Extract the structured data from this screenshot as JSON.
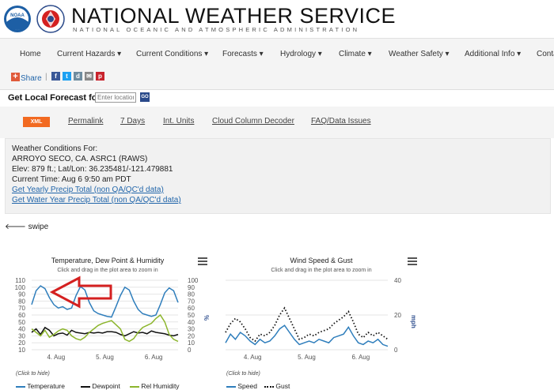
{
  "header": {
    "title": "NATIONAL WEATHER SERVICE",
    "subtitle": "NATIONAL OCEANIC AND ATMOSPHERIC ADMINISTRATION",
    "noaa_logo_text": "NOAA"
  },
  "nav": {
    "items": [
      {
        "label": "Home"
      },
      {
        "label": "Current Hazards ▾"
      },
      {
        "label": "Current Conditions ▾"
      },
      {
        "label": "Forecasts ▾"
      },
      {
        "label": "Hydrology ▾"
      },
      {
        "label": "Climate ▾"
      },
      {
        "label": "Weather Safety ▾"
      },
      {
        "label": "Additional Info ▾"
      },
      {
        "label": "Conta"
      }
    ]
  },
  "share": {
    "label": "Share",
    "icons": [
      "facebook-icon",
      "twitter-icon",
      "digg-icon",
      "email-icon",
      "pinterest-icon"
    ]
  },
  "forecast": {
    "label": "Get Local Forecast for:",
    "placeholder": "Enter location",
    "go_label": "GO"
  },
  "links": {
    "xml": "XML",
    "items": [
      {
        "label": "Permalink"
      },
      {
        "label": "7 Days"
      },
      {
        "label": "Int. Units"
      },
      {
        "label": "Cloud Column Decoder"
      },
      {
        "label": "FAQ/Data Issues"
      }
    ]
  },
  "conditions": {
    "heading": "Weather Conditions For:",
    "station": "ARROYO SECO, CA. ASRC1 (RAWS)",
    "elev": "Elev: 879 ft.; Lat/Lon: 36.235481/-121.479881",
    "time": "Current Time: Aug 6 9:50 am PDT",
    "link1": "Get Yearly Precip Total (non QA/QC'd data)",
    "link2": "Get Water Year Precip Total (non QA/QC'd data)"
  },
  "swipe": "swipe",
  "colors": {
    "temp": "#2f7ebc",
    "dew": "#111111",
    "rh": "#8cb52c",
    "gust": "#111111",
    "arrow": "#d42020",
    "link": "#2266aa"
  },
  "chart_data": [
    {
      "type": "line",
      "title": "Temperature, Dew Point & Humidity",
      "subtitle": "Click and drag in the plot area to zoom in",
      "xlabel": "",
      "ylabel": "",
      "y2label": "%",
      "x_ticks": [
        "4. Aug",
        "5. Aug",
        "6. Aug"
      ],
      "y_ticks": [
        "10",
        "20",
        "30",
        "40",
        "50",
        "60",
        "70",
        "80",
        "90",
        "100",
        "110"
      ],
      "y2_ticks": [
        "0",
        "10",
        "20",
        "30",
        "40",
        "50",
        "60",
        "70",
        "80",
        "90",
        "100"
      ],
      "ylim": [
        10,
        110
      ],
      "y2lim": [
        0,
        100
      ],
      "x": [
        0,
        2,
        4,
        6,
        8,
        10,
        12,
        14,
        16,
        18,
        20,
        22,
        24,
        26,
        28,
        30,
        32,
        34,
        36,
        38,
        40,
        42,
        44,
        46,
        48,
        50,
        52,
        54,
        56,
        58,
        60,
        62,
        64,
        66
      ],
      "series": [
        {
          "name": "Temperature",
          "axis": "left",
          "values": [
            75,
            95,
            102,
            98,
            85,
            75,
            70,
            72,
            68,
            70,
            88,
            101,
            96,
            78,
            66,
            62,
            60,
            58,
            57,
            72,
            88,
            100,
            96,
            80,
            68,
            62,
            60,
            58,
            60,
            75,
            92,
            99,
            95,
            78
          ]
        },
        {
          "name": "Dewpoint",
          "axis": "left",
          "values": [
            35,
            40,
            32,
            42,
            38,
            30,
            33,
            34,
            31,
            38,
            35,
            34,
            33,
            35,
            34,
            35,
            34,
            36,
            36,
            35,
            32,
            30,
            33,
            36,
            34,
            35,
            33,
            37,
            35,
            34,
            33,
            31,
            30,
            32
          ]
        },
        {
          "name": "Rel Humidity",
          "axis": "right",
          "values": [
            30,
            25,
            20,
            28,
            18,
            22,
            27,
            30,
            28,
            20,
            16,
            14,
            18,
            25,
            30,
            35,
            38,
            40,
            42,
            36,
            30,
            15,
            12,
            16,
            25,
            32,
            35,
            38,
            45,
            50,
            40,
            22,
            15,
            12
          ]
        }
      ],
      "click_hint": "(Click to hide)",
      "legend": [
        "Temperature",
        "Dewpoint",
        "Rel Humidity"
      ]
    },
    {
      "type": "line",
      "title": "Wind Speed & Gust",
      "subtitle": "Click and drag in the plot area to zoom in",
      "xlabel": "",
      "ylabel": "mph",
      "x_ticks": [
        "4. Aug",
        "5. Aug",
        "6. Aug"
      ],
      "y_ticks": [
        "0",
        "20",
        "40"
      ],
      "ylim": [
        0,
        40
      ],
      "x": [
        0,
        2,
        4,
        6,
        8,
        10,
        12,
        14,
        16,
        18,
        20,
        22,
        24,
        26,
        28,
        30,
        32,
        34,
        36,
        38,
        40,
        42,
        44,
        46,
        48,
        50,
        52,
        54,
        56,
        58,
        60,
        62,
        64,
        66
      ],
      "series": [
        {
          "name": "Speed",
          "style": "solid",
          "values": [
            4,
            9,
            6,
            10,
            8,
            5,
            3,
            6,
            4,
            5,
            8,
            12,
            14,
            10,
            6,
            3,
            4,
            5,
            4,
            6,
            5,
            4,
            7,
            8,
            9,
            13,
            8,
            4,
            3,
            5,
            4,
            6,
            3,
            2
          ]
        },
        {
          "name": "Gust",
          "style": "dotted",
          "values": [
            10,
            15,
            18,
            16,
            12,
            7,
            5,
            9,
            8,
            10,
            14,
            20,
            24,
            18,
            12,
            6,
            7,
            9,
            8,
            10,
            11,
            12,
            15,
            17,
            19,
            22,
            16,
            9,
            7,
            10,
            8,
            10,
            8,
            6
          ]
        }
      ],
      "click_hint": "(Click to hide)",
      "legend": [
        "Speed",
        "Gust"
      ]
    }
  ]
}
